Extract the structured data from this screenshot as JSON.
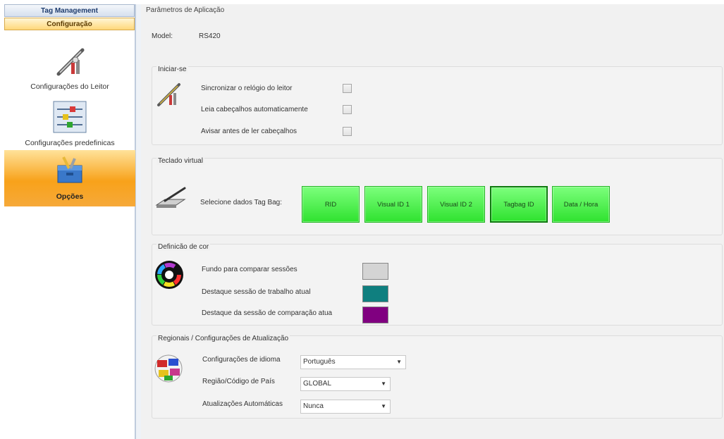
{
  "nav": {
    "header_tag_management": "Tag Management",
    "header_configuracao": "Configuração",
    "items": [
      {
        "label": "Configurações do Leitor",
        "icon": "wrench-screwdriver-icon"
      },
      {
        "label": "Configurações predefinicas",
        "icon": "sliders-icon"
      },
      {
        "label": "Opções",
        "icon": "toolbox-icon"
      }
    ]
  },
  "main": {
    "title": "Parâmetros de Aplicação",
    "model_label": "Model:",
    "model_value": "RS420"
  },
  "iniciar": {
    "title": "Iniciar-se",
    "options": [
      {
        "label": "Sincronizar o relógio do leitor",
        "checked": false
      },
      {
        "label": "Leia cabeçalhos automaticamente",
        "checked": false
      },
      {
        "label": "Avisar antes de ler cabeçalhos",
        "checked": false
      }
    ]
  },
  "teclado": {
    "title": "Teclado virtual",
    "select_label": "Selecione dados Tag Bag:",
    "buttons": [
      "RID",
      "Visual ID 1",
      "Visual ID 2",
      "Tagbag ID",
      "Data / Hora"
    ],
    "button_color": "#33e633"
  },
  "cor": {
    "title": "Definicão de cor",
    "rows": [
      {
        "label": "Fundo para comparar sessões",
        "color": "#d4d4d4"
      },
      {
        "label": "Destaque sessão de trabalho atual",
        "color": "#0f7f7f"
      },
      {
        "label": "Destaque da sessão de comparação atua",
        "color": "#800080"
      }
    ]
  },
  "regionais": {
    "title": "Regionais / Configurações de Atualização",
    "idioma_label": "Configurações de idioma",
    "idioma_value": "Português",
    "regiao_label": "Região/Código de País",
    "regiao_value": "GLOBAL",
    "atualizacoes_label": "Atualizações Automáticas",
    "atualizacoes_value": "Nunca"
  }
}
